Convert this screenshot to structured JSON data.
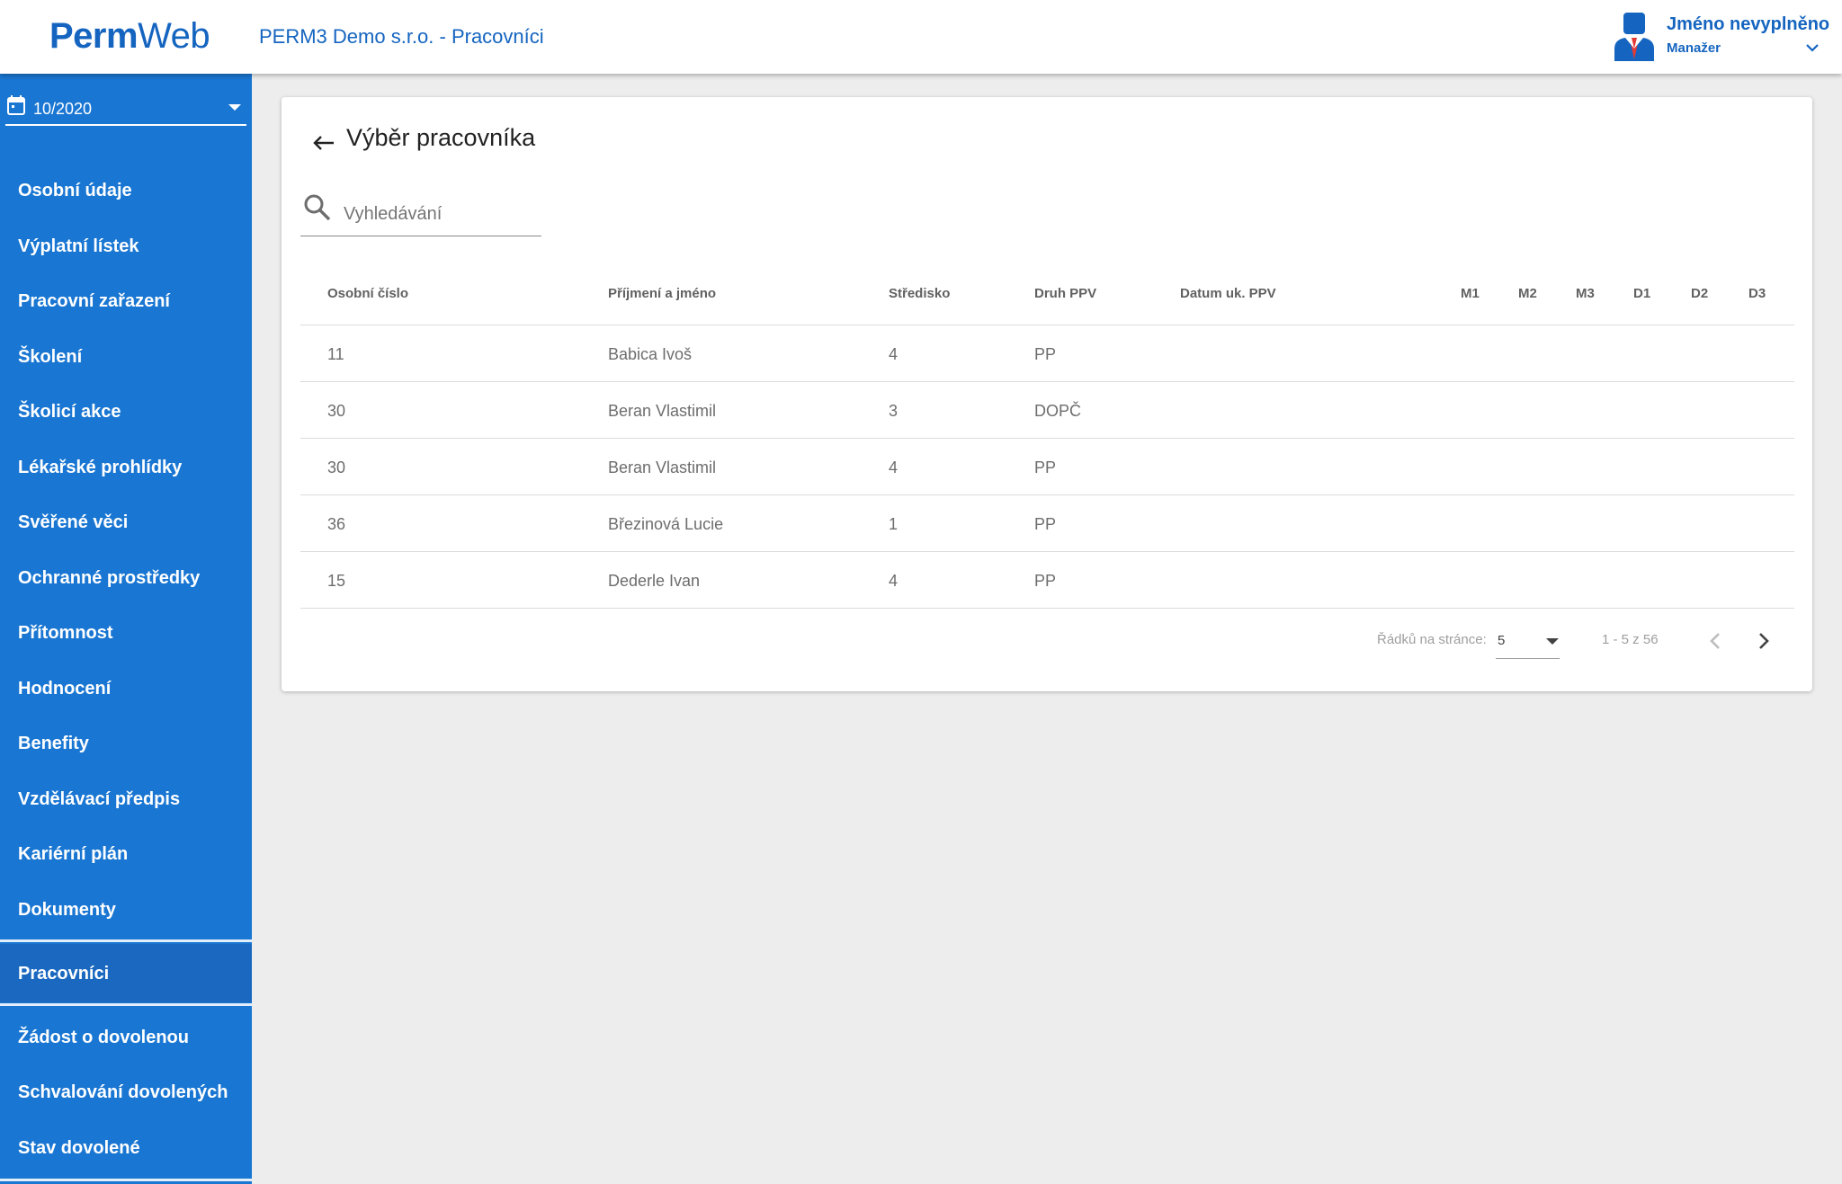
{
  "header": {
    "logo_bold": "Perm",
    "logo_light": "Web",
    "company": "PERM3 Demo s.r.o. - Pracovníci",
    "user_name": "Jméno nevyplněno",
    "user_role": "Manažer"
  },
  "sidebar": {
    "period": "10/2020",
    "items": [
      {
        "label": "Osobní údaje"
      },
      {
        "label": "Výplatní lístek"
      },
      {
        "label": "Pracovní zařazení"
      },
      {
        "label": "Školení"
      },
      {
        "label": "Školicí akce"
      },
      {
        "label": "Lékařské prohlídky"
      },
      {
        "label": "Svěřené věci"
      },
      {
        "label": "Ochranné prostředky"
      },
      {
        "label": "Přítomnost"
      },
      {
        "label": "Hodnocení"
      },
      {
        "label": "Benefity"
      },
      {
        "label": "Vzdělávací předpis"
      },
      {
        "label": "Kariérní plán"
      },
      {
        "label": "Dokumenty"
      },
      {
        "label": "Pracovníci",
        "active": true
      },
      {
        "label": "Žádost o dovolenou"
      },
      {
        "label": "Schvalování dovolených"
      },
      {
        "label": "Stav dovolené"
      }
    ]
  },
  "main": {
    "title": "Výběr pracovníka",
    "search_placeholder": "Vyhledávání",
    "columns": [
      "Osobní číslo",
      "Příjmení a jméno",
      "Středisko",
      "Druh PPV",
      "Datum uk. PPV",
      "M1",
      "M2",
      "M3",
      "D1",
      "D2",
      "D3"
    ],
    "rows": [
      [
        "11",
        "Babica Ivoš",
        "4",
        "PP",
        "",
        "",
        "",
        "",
        "",
        "",
        ""
      ],
      [
        "30",
        "Beran Vlastimil",
        "3",
        "DOPČ",
        "",
        "",
        "",
        "",
        "",
        "",
        ""
      ],
      [
        "30",
        "Beran Vlastimil",
        "4",
        "PP",
        "",
        "",
        "",
        "",
        "",
        "",
        ""
      ],
      [
        "36",
        "Březinová Lucie",
        "1",
        "PP",
        "",
        "",
        "",
        "",
        "",
        "",
        ""
      ],
      [
        "15",
        "Dederle Ivan",
        "4",
        "PP",
        "",
        "",
        "",
        "",
        "",
        "",
        ""
      ]
    ],
    "pagination": {
      "rows_label": "Řádků na stránce:",
      "rows_value": "5",
      "range": "1 - 5 z 56"
    }
  },
  "colors": {
    "primary": "#1976d2",
    "brand_text": "#1565c0",
    "background": "#ededed"
  },
  "icons": [
    "calendar-icon",
    "back-arrow-icon",
    "search-icon",
    "user-avatar-icon",
    "chevron-down-icon",
    "chevron-left-icon",
    "chevron-right-icon"
  ]
}
